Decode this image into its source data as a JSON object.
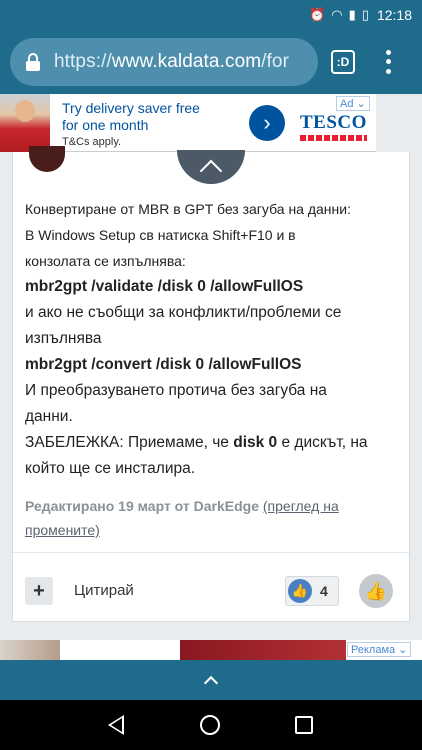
{
  "status_bar": {
    "time": "12:18",
    "icons": [
      "mail-icon",
      "alarm-icon",
      "wifi-icon",
      "signal-icon",
      "battery-icon"
    ]
  },
  "browser": {
    "url_prefix": "https://",
    "url_host": "www.kaldata.com",
    "url_rest": "/for",
    "tabs_label": ":D"
  },
  "ad_top": {
    "line1": "Try delivery saver free",
    "line2": "for one month",
    "line3": "T&Cs apply.",
    "brand": "TESCO",
    "badge": "Ad",
    "colors": {
      "brand_blue": "#00539f",
      "brand_red": "#ee1c2e"
    }
  },
  "post": {
    "lines": [
      "Конвертиране от MBR в GPT без загуба на данни:",
      "В Windows Setup св натиска Shift+F10 и в",
      "конзолата се изпълнява:"
    ],
    "cmd1": "mbr2gpt /validate /disk 0 /allowFullOS",
    "line_after_cmd1_a": "и ако не съобщи за конфликти/проблеми се",
    "line_after_cmd1_b": "изпълнява",
    "cmd2": "mbr2gpt /convert /disk 0 /allowFullOS",
    "line_after_cmd2_a": "И преобразуването протича без загуба на",
    "line_after_cmd2_b": "данни.",
    "note_prefix": "ЗАБЕЛЕЖКА: Приемаме, че ",
    "note_bold": "disk 0",
    "note_suffix": " е дискът, на",
    "note_line2": "който ще се инсталира.",
    "edited_text": "Редактирано 19 март от DarkEdge",
    "edited_link_a": "(преглед на",
    "edited_link_b": "промените)",
    "quote_label": "Цитирай",
    "plus_label": "+",
    "like_count": "4"
  },
  "ad_bottom": {
    "badge": "Реклама"
  }
}
